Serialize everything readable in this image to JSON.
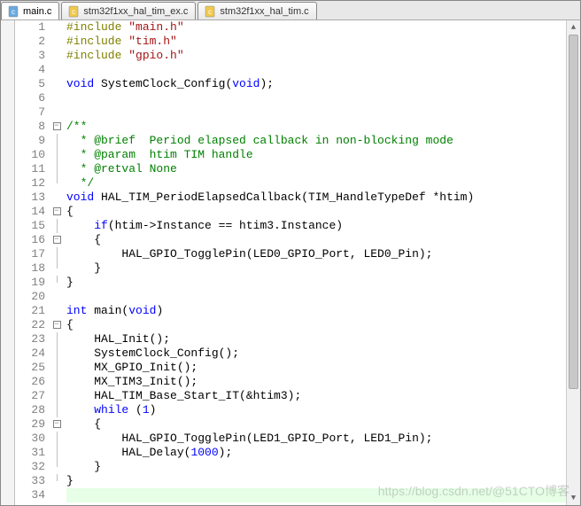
{
  "tabs": [
    {
      "label": "main.c",
      "active": true,
      "icon_color": "#6aa9e0"
    },
    {
      "label": "stm32f1xx_hal_tim_ex.c",
      "active": false,
      "icon_color": "#f0c84c"
    },
    {
      "label": "stm32f1xx_hal_tim.c",
      "active": false,
      "icon_color": "#f0c84c"
    }
  ],
  "lines": [
    {
      "n": 1,
      "fold": "",
      "segs": [
        [
          "pp",
          "#include "
        ],
        [
          "str",
          "\"main.h\""
        ]
      ]
    },
    {
      "n": 2,
      "fold": "",
      "segs": [
        [
          "pp",
          "#include "
        ],
        [
          "str",
          "\"tim.h\""
        ]
      ]
    },
    {
      "n": 3,
      "fold": "",
      "segs": [
        [
          "pp",
          "#include "
        ],
        [
          "str",
          "\"gpio.h\""
        ]
      ]
    },
    {
      "n": 4,
      "fold": "",
      "segs": []
    },
    {
      "n": 5,
      "fold": "",
      "segs": [
        [
          "kw",
          "void"
        ],
        [
          "txt",
          " SystemClock_Config("
        ],
        [
          "kw",
          "void"
        ],
        [
          "txt",
          ");"
        ]
      ]
    },
    {
      "n": 6,
      "fold": "",
      "segs": []
    },
    {
      "n": 7,
      "fold": "",
      "segs": []
    },
    {
      "n": 8,
      "fold": "box",
      "segs": [
        [
          "cmt",
          "/**"
        ]
      ]
    },
    {
      "n": 9,
      "fold": "line",
      "segs": [
        [
          "cmt",
          "  * @brief  Period elapsed callback in non-blocking mode"
        ]
      ]
    },
    {
      "n": 10,
      "fold": "line",
      "segs": [
        [
          "cmt",
          "  * @param  htim TIM handle"
        ]
      ]
    },
    {
      "n": 11,
      "fold": "line",
      "segs": [
        [
          "cmt",
          "  * @retval None"
        ]
      ]
    },
    {
      "n": 12,
      "fold": "end",
      "segs": [
        [
          "cmt",
          "  */"
        ]
      ]
    },
    {
      "n": 13,
      "fold": "",
      "segs": [
        [
          "kw",
          "void"
        ],
        [
          "txt",
          " HAL_TIM_PeriodElapsedCallback(TIM_HandleTypeDef *htim)"
        ]
      ]
    },
    {
      "n": 14,
      "fold": "box",
      "segs": [
        [
          "txt",
          "{"
        ]
      ]
    },
    {
      "n": 15,
      "fold": "line",
      "segs": [
        [
          "txt",
          "    "
        ],
        [
          "kw",
          "if"
        ],
        [
          "txt",
          "(htim->Instance == htim3.Instance)"
        ]
      ]
    },
    {
      "n": 16,
      "fold": "box",
      "segs": [
        [
          "txt",
          "    {"
        ]
      ]
    },
    {
      "n": 17,
      "fold": "line",
      "segs": [
        [
          "txt",
          "        HAL_GPIO_TogglePin(LED0_GPIO_Port, LED0_Pin);"
        ]
      ]
    },
    {
      "n": 18,
      "fold": "end",
      "segs": [
        [
          "txt",
          "    }"
        ]
      ]
    },
    {
      "n": 19,
      "fold": "end",
      "segs": [
        [
          "txt",
          "}"
        ]
      ]
    },
    {
      "n": 20,
      "fold": "",
      "segs": []
    },
    {
      "n": 21,
      "fold": "",
      "segs": [
        [
          "kw",
          "int"
        ],
        [
          "txt",
          " main("
        ],
        [
          "kw",
          "void"
        ],
        [
          "txt",
          ")"
        ]
      ]
    },
    {
      "n": 22,
      "fold": "box",
      "segs": [
        [
          "txt",
          "{"
        ]
      ]
    },
    {
      "n": 23,
      "fold": "line",
      "segs": [
        [
          "txt",
          "    HAL_Init();"
        ]
      ]
    },
    {
      "n": 24,
      "fold": "line",
      "segs": [
        [
          "txt",
          "    SystemClock_Config();"
        ]
      ]
    },
    {
      "n": 25,
      "fold": "line",
      "segs": [
        [
          "txt",
          "    MX_GPIO_Init();"
        ]
      ]
    },
    {
      "n": 26,
      "fold": "line",
      "segs": [
        [
          "txt",
          "    MX_TIM3_Init();"
        ]
      ]
    },
    {
      "n": 27,
      "fold": "line",
      "segs": [
        [
          "txt",
          "    HAL_TIM_Base_Start_IT(&htim3);"
        ]
      ]
    },
    {
      "n": 28,
      "fold": "line",
      "segs": [
        [
          "txt",
          "    "
        ],
        [
          "kw",
          "while"
        ],
        [
          "txt",
          " ("
        ],
        [
          "num",
          "1"
        ],
        [
          "txt",
          ")"
        ]
      ]
    },
    {
      "n": 29,
      "fold": "box",
      "segs": [
        [
          "txt",
          "    {"
        ]
      ]
    },
    {
      "n": 30,
      "fold": "line",
      "segs": [
        [
          "txt",
          "        HAL_GPIO_TogglePin(LED1_GPIO_Port, LED1_Pin);"
        ]
      ]
    },
    {
      "n": 31,
      "fold": "line",
      "segs": [
        [
          "txt",
          "        HAL_Delay("
        ],
        [
          "num",
          "1000"
        ],
        [
          "txt",
          ");"
        ]
      ]
    },
    {
      "n": 32,
      "fold": "end",
      "segs": [
        [
          "txt",
          "    }"
        ]
      ]
    },
    {
      "n": 33,
      "fold": "end",
      "segs": [
        [
          "txt",
          "}"
        ]
      ]
    },
    {
      "n": 34,
      "fold": "",
      "segs": [],
      "highlight": true
    }
  ],
  "watermark": "https://blog.csdn.net/@51CTO博客"
}
